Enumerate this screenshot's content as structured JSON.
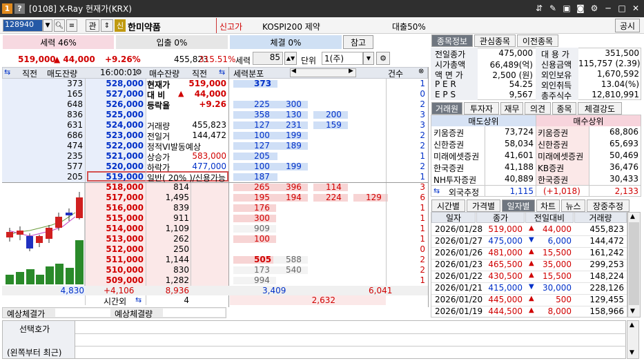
{
  "window": {
    "badge1": "1",
    "badge2": "?",
    "title": "[0108] X-Ray 현재가(KRX)",
    "icons": [
      "pin-icon",
      "memo-icon",
      "save-icon",
      "camera-icon",
      "gear-icon",
      "minimize-icon",
      "maximize-icon",
      "close-icon"
    ]
  },
  "toolbar": {
    "code": "128940",
    "btn_manage": "관",
    "credit_badge": "신",
    "stock_name": "한미약품",
    "tag_new_high": "신고가",
    "index_name": "KOSPI200 제약",
    "loan_ratio": "대출50%",
    "notice": "공시"
  },
  "row2": {
    "force": "세력 46%",
    "inflow": "입출 0%",
    "exec": "체결 0%",
    "ref_btn": "참고"
  },
  "price_line": {
    "price": "519,000",
    "change": "▲ 44,000",
    "rate": "+9.26%",
    "volume": "455,823",
    "vol_ratio": "315.51%"
  },
  "force_ctrl": {
    "label": "세력",
    "value": "85",
    "unit_label": "단위",
    "unit_value": "1(주)"
  },
  "ob_header": {
    "prev": "직전",
    "ask_qty": "매도잔량",
    "time": "16:00:01",
    "bid_qty": "매수잔량",
    "prev2": "직전",
    "dist": "세력분포",
    "count": "건수"
  },
  "asks": [
    {
      "prev": "373",
      "price": "528,000",
      "info_l": "현재가",
      "info_r": "519,000",
      "d": [
        "373",
        "",
        ""
      ],
      "n": "1"
    },
    {
      "prev": "165",
      "price": "527,000",
      "info_l": "대 비",
      "info_mid": "▲",
      "info_r": "44,000",
      "d": [
        "",
        "",
        ""
      ],
      "n": "0"
    },
    {
      "prev": "648",
      "price": "526,000",
      "info_l": "등락율",
      "info_r": "+9.26",
      "d": [
        "225",
        "300",
        ""
      ],
      "n": "2"
    },
    {
      "prev": "836",
      "price": "525,000",
      "info_l": "",
      "info_r": "",
      "d": [
        "358",
        "130",
        "200"
      ],
      "n": "3"
    },
    {
      "prev": "631",
      "price": "524,000",
      "info_l": "거래량",
      "info_r": "455,823",
      "d": [
        "127",
        "231",
        "159"
      ],
      "n": "3"
    },
    {
      "prev": "686",
      "price": "523,000",
      "info_l": "전일거",
      "info_r": "144,472",
      "d": [
        "100",
        "199",
        ""
      ],
      "n": "2"
    },
    {
      "prev": "474",
      "price": "522,000",
      "info_l": "정적VI발동예상",
      "info_r": "",
      "d": [
        "127",
        "189",
        ""
      ],
      "n": "2"
    },
    {
      "prev": "235",
      "price": "521,000",
      "info_l": "상승가",
      "info_r": "583,000",
      "d": [
        "205",
        "",
        ""
      ],
      "n": "1"
    },
    {
      "prev": "577",
      "price": "520,000",
      "info_l": "하락가",
      "info_r": "477,000",
      "d": [
        "100",
        "199",
        ""
      ],
      "n": "2"
    },
    {
      "prev": "205",
      "price": "519,000",
      "info_l": "일반( 20% )/신용가능",
      "info_r": "",
      "d": [
        "187",
        "",
        ""
      ],
      "n": "1"
    }
  ],
  "bids": [
    {
      "price": "518,000",
      "qty": "814",
      "d": [
        "265",
        "396",
        "114",
        ""
      ],
      "n": "3"
    },
    {
      "price": "517,000",
      "qty": "1,495",
      "d": [
        "195",
        "194",
        "224",
        "129"
      ],
      "n": "6"
    },
    {
      "price": "516,000",
      "qty": "839",
      "d": [
        "176",
        "",
        "",
        ""
      ],
      "n": "1"
    },
    {
      "price": "515,000",
      "qty": "911",
      "d": [
        "300",
        "",
        "",
        ""
      ],
      "n": "1"
    },
    {
      "price": "514,000",
      "qty": "1,109",
      "d": [
        "909",
        "",
        "",
        ""
      ],
      "n": "1"
    },
    {
      "price": "513,000",
      "qty": "262",
      "d": [
        "100",
        "",
        "",
        ""
      ],
      "n": "1"
    },
    {
      "price": "512,000",
      "qty": "250",
      "d": [
        "",
        "",
        "",
        ""
      ],
      "n": "0"
    },
    {
      "price": "511,000",
      "qty": "1,144",
      "d": [
        "505",
        "588",
        "",
        ""
      ],
      "n": "2"
    },
    {
      "price": "510,000",
      "qty": "830",
      "d": [
        "173",
        "540",
        "",
        ""
      ],
      "n": "2"
    },
    {
      "price": "509,000",
      "qty": "1,282",
      "d": [
        "994",
        "",
        "",
        ""
      ],
      "n": "1"
    }
  ],
  "totals": {
    "ask_total": "4,830",
    "diff": "+4,106",
    "bid_total": "8,936",
    "dist_ask": "3,409",
    "dist_bid": "6,041",
    "after_label": "시간외",
    "after_val": "4",
    "dist_sum": "2,632"
  },
  "expected": {
    "price_label": "예상체결가",
    "qty_label": "예상체결량"
  },
  "bottom": {
    "line1": "선택호가",
    "line2": "(왼쪽부터 최근)"
  },
  "info_tabs": [
    "종목정보",
    "관심종목",
    "이전종목"
  ],
  "info": [
    [
      "전일종가",
      "475,000",
      "대 용 가",
      "351,500"
    ],
    [
      "시가총액",
      "66,489(억)",
      "신용금액",
      "115,757  (2.39)"
    ],
    [
      "액 면 가",
      "2,500 (원)",
      "외인보유",
      "1,670,592"
    ],
    [
      "P E R",
      "54.25",
      "외인취득",
      "13.04(%)"
    ],
    [
      "E P S",
      "9,567",
      "총주식수",
      "12,810,991"
    ]
  ],
  "broker_tabs": [
    "거래원",
    "투자자",
    "재무",
    "의견",
    "종목",
    "체결강도"
  ],
  "broker": {
    "sell_head": "매도상위",
    "buy_head": "매수상위",
    "rows": [
      [
        "키움증권",
        "73,724",
        "키움증권",
        "68,806"
      ],
      [
        "신한증권",
        "58,034",
        "신한증권",
        "65,693"
      ],
      [
        "미래에셋증권",
        "41,601",
        "미래에셋증권",
        "50,469"
      ],
      [
        "한국증권",
        "41,188",
        "KB증권",
        "36,476"
      ],
      [
        "NH투자증권",
        "40,889",
        "한국증권",
        "30,433"
      ]
    ],
    "foreign_label": "외국추정",
    "foreign_sell": "1,115",
    "foreign_diff": "(+1,018)",
    "foreign_buy": "2,133"
  },
  "daily_tabs": [
    "시간별",
    "가격별",
    "일자별",
    "차트",
    "뉴스",
    "장중추정"
  ],
  "daily": {
    "headers": [
      "일자",
      "종가",
      "전일대비",
      "거래량"
    ],
    "rows": [
      {
        "date": "2026/01/28",
        "close": "519,000",
        "dir": "▲",
        "chg": "44,000",
        "vol": "455,823",
        "up": true
      },
      {
        "date": "2026/01/27",
        "close": "475,000",
        "dir": "▼",
        "chg": "6,000",
        "vol": "144,472",
        "up": false
      },
      {
        "date": "2026/01/26",
        "close": "481,000",
        "dir": "▲",
        "chg": "15,500",
        "vol": "161,242",
        "up": true
      },
      {
        "date": "2026/01/23",
        "close": "465,500",
        "dir": "▲",
        "chg": "35,000",
        "vol": "299,253",
        "up": true
      },
      {
        "date": "2026/01/22",
        "close": "430,500",
        "dir": "▲",
        "chg": "15,500",
        "vol": "148,224",
        "up": true
      },
      {
        "date": "2026/01/21",
        "close": "415,000",
        "dir": "▼",
        "chg": "30,000",
        "vol": "228,126",
        "up": false
      },
      {
        "date": "2026/01/20",
        "close": "445,000",
        "dir": "▲",
        "chg": "500",
        "vol": "129,455",
        "up": true
      },
      {
        "date": "2026/01/19",
        "close": "444,500",
        "dir": "▲",
        "chg": "8,000",
        "vol": "158,966",
        "up": true
      }
    ]
  },
  "colors": {
    "up": "#d00000",
    "down": "#0030c8",
    "ask_bg": "#e8eefa",
    "bid_bg": "#fbe8e8",
    "title_bg": "#2f2f2f"
  }
}
